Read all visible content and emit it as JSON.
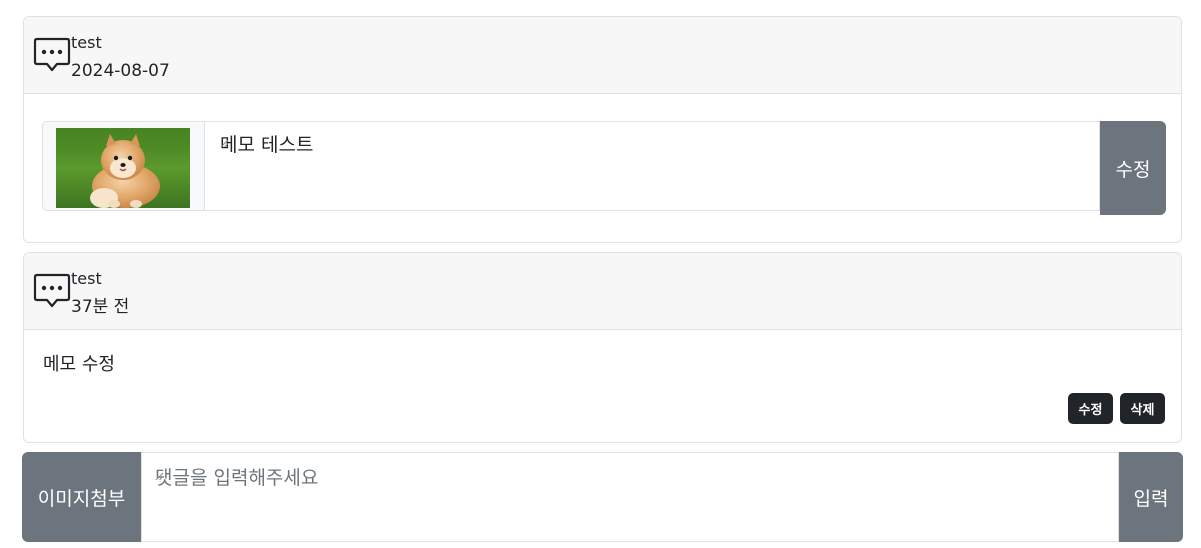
{
  "comments": [
    {
      "author": "test",
      "date": "2024-08-07",
      "editing": true,
      "edit_value": "메모 테스트",
      "edit_button_label": "수정"
    },
    {
      "author": "test",
      "date": "37분 전",
      "editing": false,
      "text": "메모 수정",
      "edit_label": "수정",
      "delete_label": "삭제"
    }
  ],
  "composer": {
    "attach_label": "이미지첨부",
    "placeholder": "댓글을 입력해주세요",
    "submit_label": "입력"
  },
  "icons": {
    "comment": "chat-dots-icon",
    "thumbnail": "dog-photo"
  },
  "colors": {
    "secondary": "#6c757d",
    "dark": "#212529",
    "header_bg": "#f7f7f7",
    "border": "#dee2e6"
  }
}
